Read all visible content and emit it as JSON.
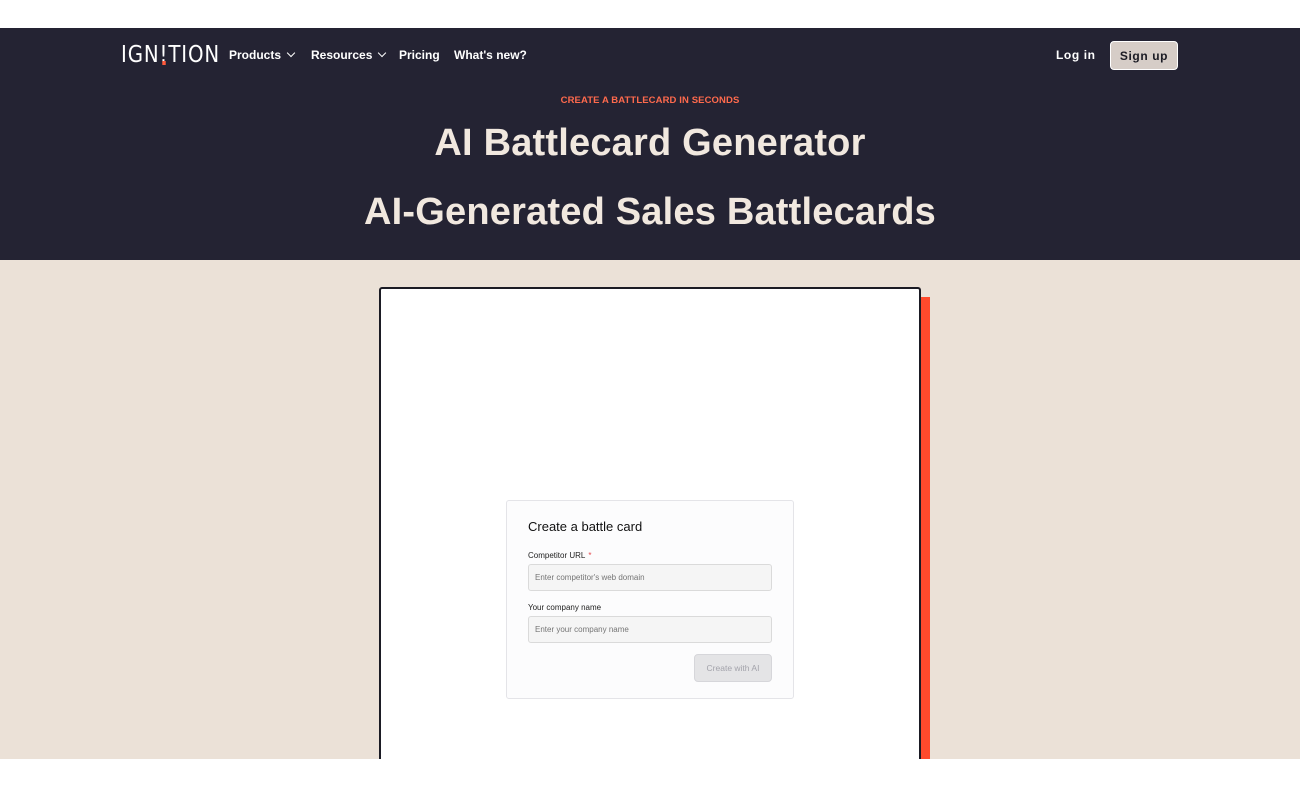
{
  "colors": {
    "hero_background": "#242333",
    "accent": "#ff5a3c",
    "heading_text": "#f1e8df",
    "page_background": "#ebe1d7",
    "card_shadow": "#ff4a2c"
  },
  "nav": {
    "logo_prefix": "IGN",
    "logo_bang": "!",
    "logo_suffix": "TION",
    "items": [
      {
        "label": "Products",
        "has_dropdown": true,
        "icon": "chevron-down-icon"
      },
      {
        "label": "Resources",
        "has_dropdown": true,
        "icon": "chevron-down-icon"
      },
      {
        "label": "Pricing",
        "has_dropdown": false
      },
      {
        "label": "What's new?",
        "has_dropdown": false
      }
    ],
    "login_label": "Log in",
    "signup_label": "Sign up"
  },
  "hero": {
    "eyebrow": "CREATE A BATTLECARD IN SECONDS",
    "title": "AI Battlecard Generator",
    "subtitle": "AI-Generated Sales Battlecards"
  },
  "form": {
    "title": "Create a battle card",
    "competitor_label": "Competitor URL",
    "required_mark": "*",
    "competitor_placeholder": "Enter competitor's web domain",
    "company_label": "Your company name",
    "company_placeholder": "Enter your company name",
    "submit_label": "Create with AI"
  }
}
